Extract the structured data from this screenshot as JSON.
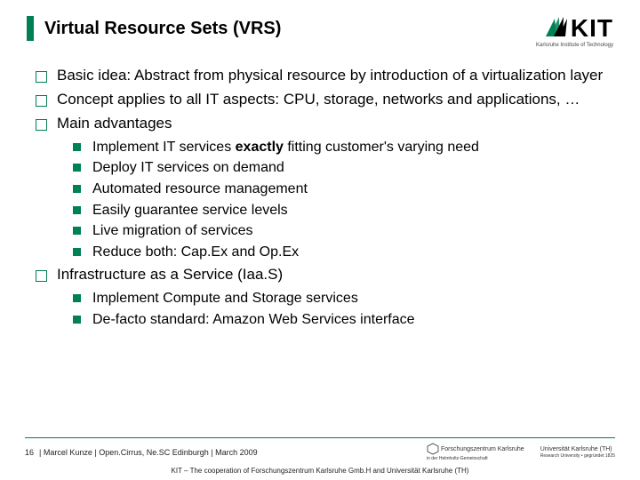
{
  "title": "Virtual Resource Sets (VRS)",
  "logo": {
    "text": "KIT",
    "sub": "Karlsruhe Institute of Technology"
  },
  "bullets": [
    {
      "text": "Basic idea: Abstract from physical resource by introduction of a virtualization layer"
    },
    {
      "text": "Concept applies to all IT aspects: CPU, storage, networks and applications, …"
    },
    {
      "text": "Main advantages",
      "children": [
        {
          "pre": "Implement IT services ",
          "bold": "exactly",
          "post": " fitting customer's varying need"
        },
        {
          "text": "Deploy IT services on demand"
        },
        {
          "text": "Automated resource management"
        },
        {
          "text": "Easily guarantee service levels"
        },
        {
          "text": "Live migration of services"
        },
        {
          "text": "Reduce both: Cap.Ex and Op.Ex"
        }
      ]
    },
    {
      "text": "Infrastructure as a Service (Iaa.S)",
      "children": [
        {
          "text": "Implement Compute and Storage services"
        },
        {
          "text": "De-facto standard: Amazon Web Services interface"
        }
      ]
    }
  ],
  "footer": {
    "page": "16",
    "meta": "| Marcel Kunze | Open.Cirrus, Ne.SC Edinburgh | March 2009",
    "logo1": "Forschungszentrum Karlsruhe",
    "logo1b": "in der Helmholtz-Gemeinschaft",
    "logo2": "Universität Karlsruhe (TH)",
    "logo2b": "Research University • gegründet 1825",
    "bottom": "KIT – The cooperation of Forschungszentrum Karlsruhe Gmb.H and Universität Karlsruhe (TH)"
  }
}
